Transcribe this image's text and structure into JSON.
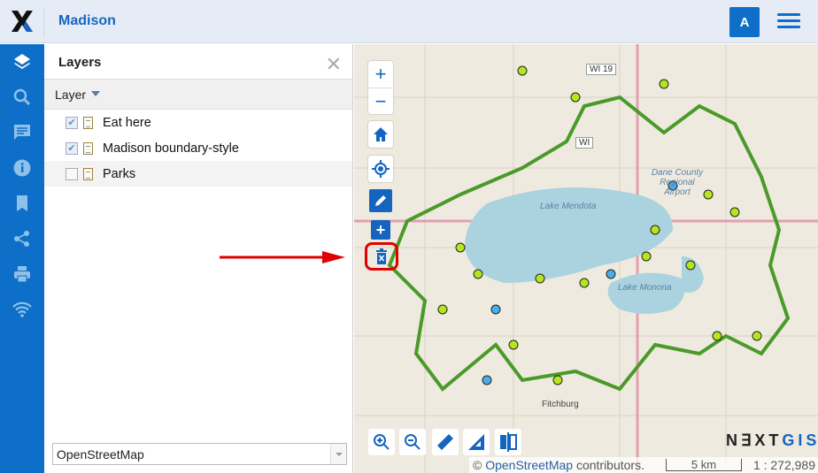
{
  "header": {
    "title": "Madison",
    "user_initial": "A"
  },
  "sidebar": {
    "items": [
      "layers-icon",
      "search-icon",
      "comment-icon",
      "info-icon",
      "bookmark-icon",
      "share-icon",
      "print-icon",
      "wifi-icon"
    ]
  },
  "panel": {
    "title": "Layers",
    "column_header": "Layer",
    "layers": [
      {
        "label": "Eat here",
        "checked": true
      },
      {
        "label": "Madison boundary-style",
        "checked": true
      },
      {
        "label": "Parks",
        "checked": false
      }
    ],
    "basemap": "OpenStreetMap"
  },
  "map": {
    "labels": {
      "lake1": "Lake Mendota",
      "lake2": "Lake Monona",
      "town": "Fitchburg",
      "airport": "Dane County Regional Airport",
      "hw1": "WI 19",
      "hw2": "WI"
    },
    "attribution_prefix": "© ",
    "attribution_link": "OpenStreetMap",
    "attribution_suffix": " contributors.",
    "scale": "5 km",
    "ratio": "1 : 272,989",
    "brand_a": "N∃XT",
    "brand_b": "GIS"
  },
  "colors": {
    "accent": "#0d6fc7",
    "boundary": "#4a9a2a",
    "point_green": "#b5e61d",
    "point_blue": "#4aaee8",
    "highlight": "#e00000"
  }
}
